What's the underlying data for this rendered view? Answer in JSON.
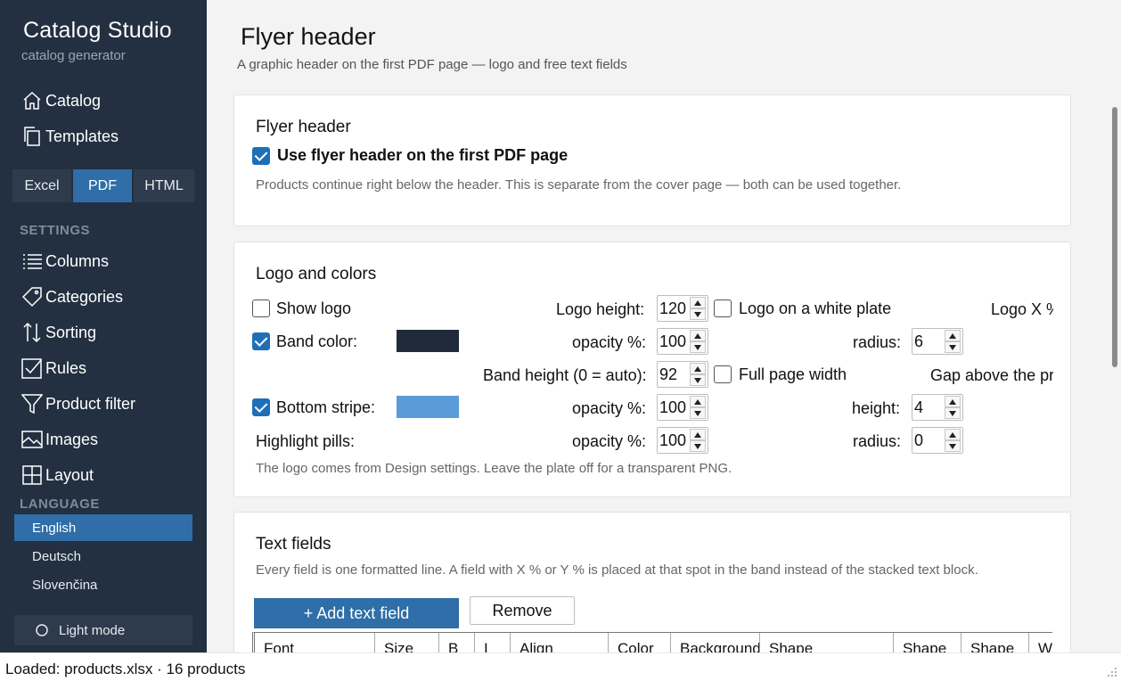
{
  "app": {
    "title": "Catalog Studio",
    "subtitle": "catalog generator"
  },
  "sidebar": {
    "nav_top": [
      {
        "label": "Catalog",
        "icon": "home-icon"
      },
      {
        "label": "Templates",
        "icon": "templates-icon"
      }
    ],
    "format_tabs": [
      {
        "label": "Excel",
        "active": false
      },
      {
        "label": "PDF",
        "active": true
      },
      {
        "label": "HTML",
        "active": false
      }
    ],
    "settings_label": "SETTINGS",
    "settings_items": [
      {
        "label": "Columns",
        "icon": "list-icon"
      },
      {
        "label": "Categories",
        "icon": "tag-icon"
      },
      {
        "label": "Sorting",
        "icon": "sort-icon"
      },
      {
        "label": "Rules",
        "icon": "checkbox-icon"
      },
      {
        "label": "Product filter",
        "icon": "filter-icon"
      },
      {
        "label": "Images",
        "icon": "image-icon"
      },
      {
        "label": "Layout",
        "icon": "grid-icon"
      }
    ],
    "language_label": "LANGUAGE",
    "languages": [
      {
        "label": "English",
        "active": true
      },
      {
        "label": "Deutsch",
        "active": false
      },
      {
        "label": "Slovenčina",
        "active": false
      }
    ],
    "mode_button": "Light mode"
  },
  "page": {
    "title": "Flyer header",
    "subtitle": "A graphic header on the first PDF page — logo and free text fields"
  },
  "flyer_card": {
    "title": "Flyer header",
    "use_flyer_label": "Use flyer header on the first PDF page",
    "use_flyer_checked": true,
    "help": "Products continue right below the header. This is separate from the cover page — both can be used together."
  },
  "logo_card": {
    "title": "Logo and colors",
    "show_logo_label": "Show logo",
    "show_logo_checked": false,
    "logo_height_label": "Logo height:",
    "logo_height_value": "120",
    "logo_plate_label": "Logo on a white plate",
    "logo_plate_checked": false,
    "logo_x_label": "Logo X %",
    "band_color_label": "Band color:",
    "band_color_checked": true,
    "band_color": "#1f2b3b",
    "band_opacity_label": "opacity %:",
    "band_opacity_value": "100",
    "band_radius_label": "radius:",
    "band_radius_value": "6",
    "band_height_label": "Band height (0 = auto):",
    "band_height_value": "92",
    "full_width_label": "Full page width",
    "full_width_checked": false,
    "gap_label": "Gap above the pr",
    "bottom_stripe_label": "Bottom stripe:",
    "bottom_stripe_checked": true,
    "bottom_stripe_color": "#5b9bd8",
    "stripe_opacity_label": "opacity %:",
    "stripe_opacity_value": "100",
    "stripe_height_label": "height:",
    "stripe_height_value": "4",
    "pills_label": "Highlight pills:",
    "pills_opacity_label": "opacity %:",
    "pills_opacity_value": "100",
    "pills_radius_label": "radius:",
    "pills_radius_value": "0",
    "help": "The logo comes from Design settings. Leave the plate off for a transparent PNG."
  },
  "text_card": {
    "title": "Text fields",
    "help": "Every field is one formatted line. A field with X % or Y % is placed at that spot in the band instead of the stacked text block.",
    "add_button": "+ Add text field",
    "remove_button": "Remove",
    "columns": [
      "Font",
      "Size",
      "B",
      "I",
      "Align",
      "Color",
      "Background",
      "Shape",
      "Shape",
      "Shape",
      "W"
    ]
  },
  "status": {
    "text": "Loaded: products.xlsx · 16 products"
  },
  "colors": {
    "sidebar_bg": "#223041",
    "accent": "#2f6ea8",
    "checkbox": "#1f6fb8"
  }
}
